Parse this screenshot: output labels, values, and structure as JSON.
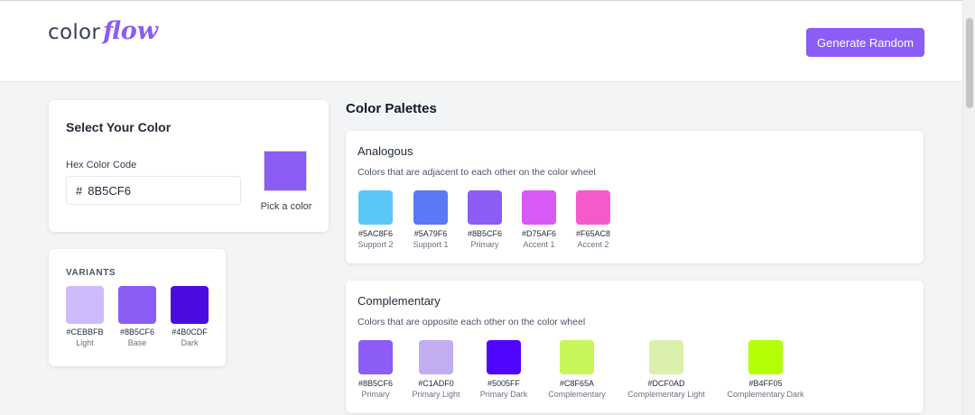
{
  "header": {
    "logo_part1": "color",
    "logo_part2": "flow",
    "generate_label": "Generate Random"
  },
  "selector": {
    "title": "Select Your Color",
    "hex_label": "Hex Color Code",
    "hash": "#",
    "hex_value": "8B5CF6",
    "picker_color": "#8B5CF6",
    "picker_label": "Pick a color"
  },
  "variants": {
    "title": "VARIANTS",
    "items": [
      {
        "hex": "#CEBBFB",
        "label": "Light"
      },
      {
        "hex": "#8B5CF6",
        "label": "Base"
      },
      {
        "hex": "#4B0CDF",
        "label": "Dark"
      }
    ]
  },
  "palettes": {
    "heading": "Color Palettes",
    "analogous": {
      "title": "Analogous",
      "description": "Colors that are adjacent to each other on the color wheel",
      "swatches": [
        {
          "hex": "#5AC8F6",
          "label": "Support 2"
        },
        {
          "hex": "#5A79F6",
          "label": "Support 1"
        },
        {
          "hex": "#8B5CF6",
          "label": "Primary"
        },
        {
          "hex": "#D75AF6",
          "label": "Accent 1"
        },
        {
          "hex": "#F65AC8",
          "label": "Accent 2"
        }
      ]
    },
    "complementary": {
      "title": "Complementary",
      "description": "Colors that are opposite each other on the color wheel",
      "swatches": [
        {
          "hex": "#8B5CF6",
          "label": "Primary"
        },
        {
          "hex": "#C1ADF0",
          "label": "Primary Light"
        },
        {
          "hex": "#5005FF",
          "label": "Primary Dark"
        },
        {
          "hex": "#C8F65A",
          "label": "Complementary"
        },
        {
          "hex": "#DCF0AD",
          "label": "Complementary Light"
        },
        {
          "hex": "#B4FF05",
          "label": "Complementary Dark"
        }
      ]
    }
  },
  "colors": {
    "accent": "#8B5CF6",
    "background": "#F3F4F6",
    "card": "#FFFFFF"
  }
}
